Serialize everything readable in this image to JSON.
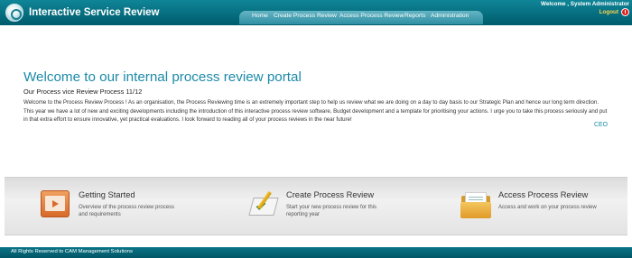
{
  "header": {
    "app_title": "Interactive Service Review",
    "welcome": "Welcome ,  System Administrator",
    "logout": "Logout",
    "nav": [
      "Home",
      "Create Process Review",
      "Access Process Review",
      "Reports",
      "Administration"
    ]
  },
  "main": {
    "title": "Welcome to our internal process review portal",
    "subtitle": "Our Process vice Review Process 11/12",
    "body": "Welcome to the Process Review Process ! As an organisation, the Process Reviewing  time is an extremely important step to help us review what we are doing on a day to day basis to our Strategic Plan and hence our long term direction.  This year we have a lot of new and exciting developments including the introduction of this interactive process review  software, Budget development and a template for prioritising your actions.  I urge you to take this process seriously and put in that extra effort to ensure innovative, yet practical evaluations. I look forward to reading all of your process reviews in the near future!",
    "signature": "CEO"
  },
  "features": [
    {
      "title": "Getting Started",
      "desc": "Overview of the process review process and requirements",
      "icon": "presentation-icon"
    },
    {
      "title": "Create Process Review",
      "desc": "Start your new process review for this reporting year",
      "icon": "pencil-paper-icon"
    },
    {
      "title": "Access Process Review",
      "desc": "Access and work on your process review",
      "icon": "folder-icon"
    }
  ],
  "footer": {
    "text": "All Rights Reserved to CAM Management Solutions"
  },
  "colors": {
    "header": "#0a7487",
    "title": "#1c8aa8",
    "logout": "#ffd34a"
  }
}
